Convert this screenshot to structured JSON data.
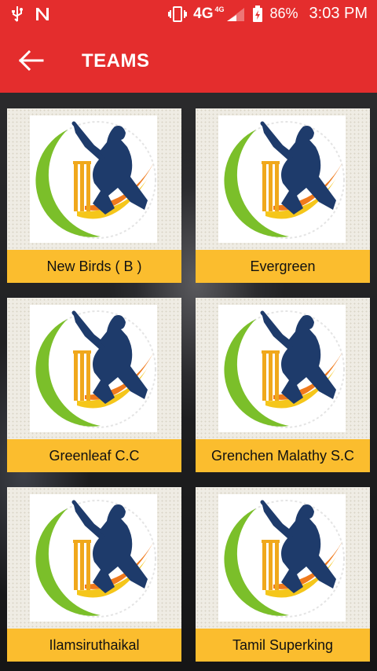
{
  "status_bar": {
    "time": "3:03 PM",
    "battery": "86%",
    "network": "4G",
    "network_small": "4G"
  },
  "app_bar": {
    "title": "TEAMS",
    "back_icon": "arrow-left-icon"
  },
  "teams": [
    {
      "name": "New Birds ( B )"
    },
    {
      "name": "Evergreen"
    },
    {
      "name": "Greenleaf C.C"
    },
    {
      "name": "Grenchen Malathy S.C"
    },
    {
      "name": "Ilamsiruthaikal"
    },
    {
      "name": "Tamil Superking"
    }
  ],
  "colors": {
    "accent": "#e42d2d",
    "label_bg": "#fbbd2e",
    "logo_blue": "#1e3b6b",
    "logo_green": "#7bbf2a",
    "logo_orange": "#f07a1c",
    "logo_yellow": "#f5c61a"
  }
}
